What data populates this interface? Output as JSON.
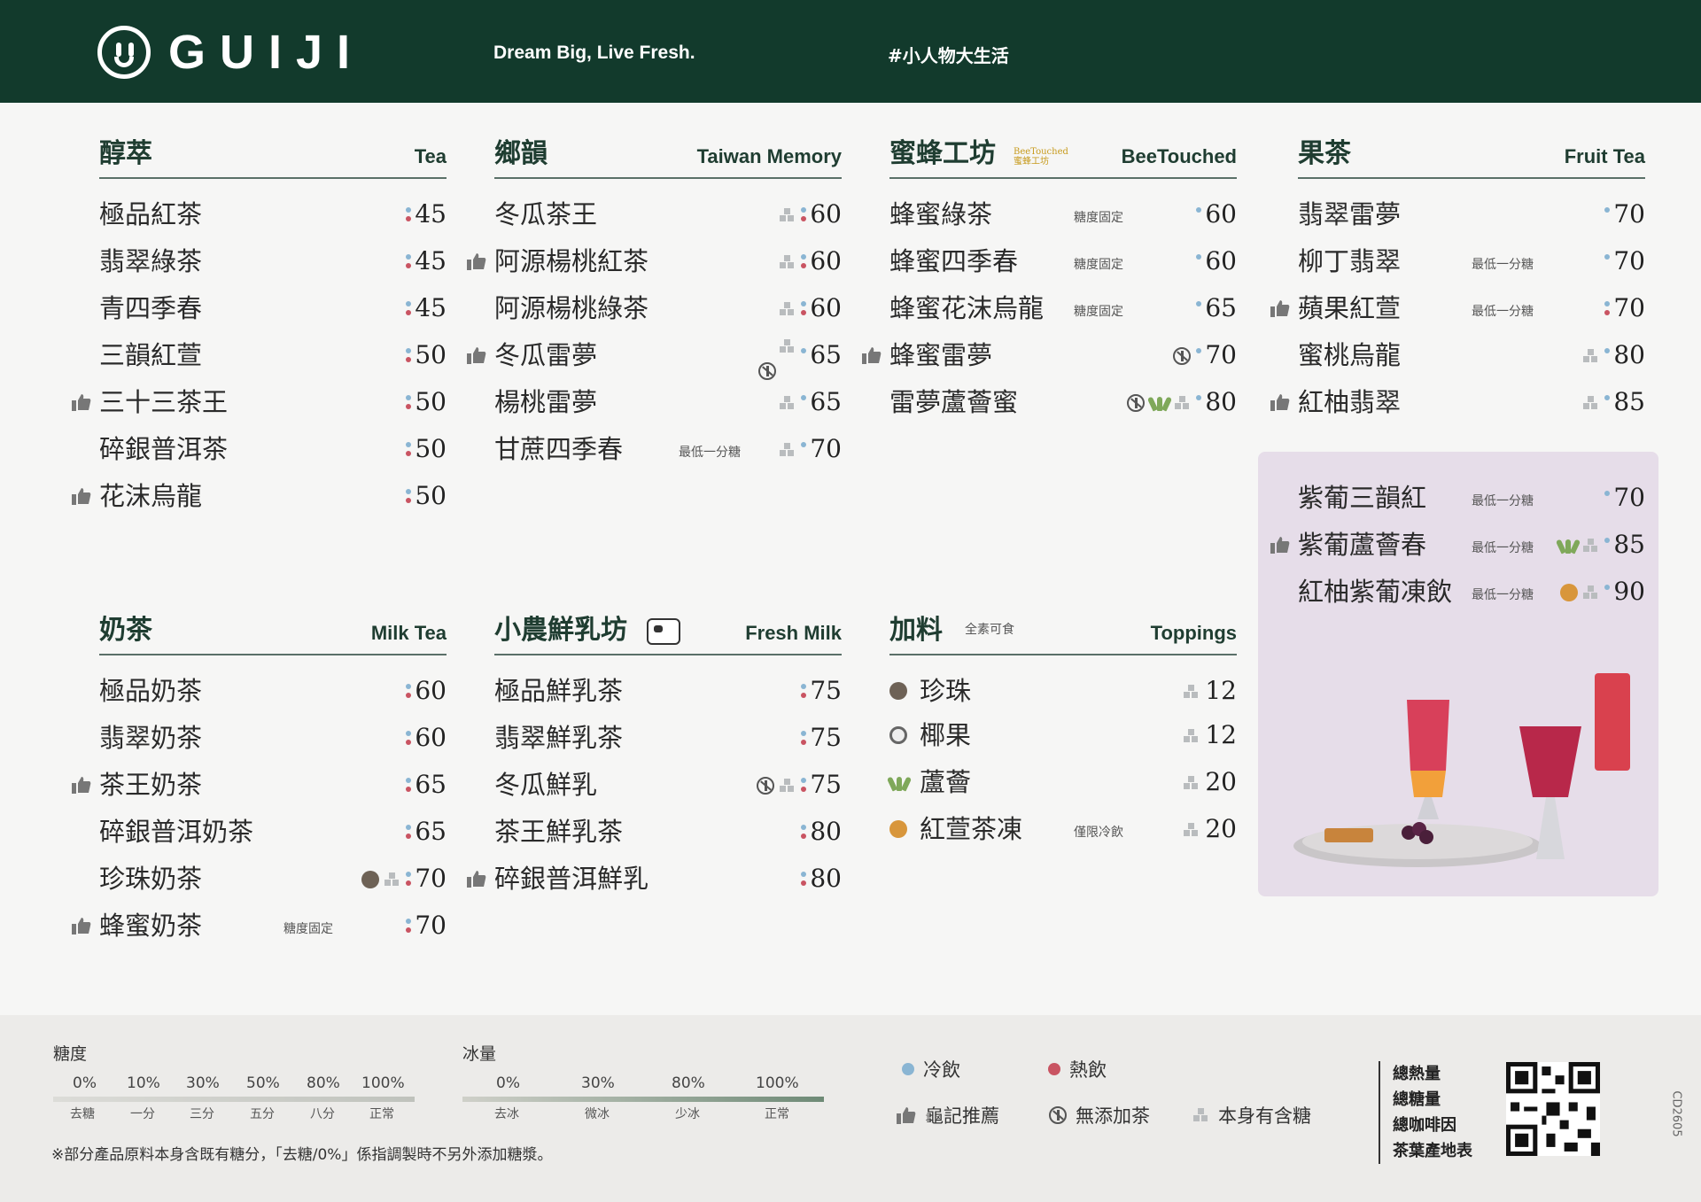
{
  "header": {
    "brand": "GUIJI",
    "tagline": "Dream Big, Live Fresh.",
    "hashtag": "#小人物大生活"
  },
  "colors": {
    "header_bg": "#123a2c",
    "cold_dot": "#8ab5d3",
    "hot_dot": "#c95462",
    "promo_bg": "#e6dde9"
  },
  "sections": {
    "tea": {
      "title": "醇萃",
      "en": "Tea",
      "items": [
        {
          "name": "極品紅茶",
          "price": "45"
        },
        {
          "name": "翡翠綠茶",
          "price": "45"
        },
        {
          "name": "青四季春",
          "price": "45"
        },
        {
          "name": "三韻紅萱",
          "price": "50"
        },
        {
          "name": "三十三茶王",
          "price": "50",
          "recommended": true
        },
        {
          "name": "碎銀普洱茶",
          "price": "50"
        },
        {
          "name": "花沫烏龍",
          "price": "50",
          "recommended": true
        }
      ]
    },
    "taiwan": {
      "title": "鄉韻",
      "en": "Taiwan Memory",
      "items": [
        {
          "name": "冬瓜茶王",
          "price": "60"
        },
        {
          "name": "阿源楊桃紅茶",
          "price": "60",
          "recommended": true
        },
        {
          "name": "阿源楊桃綠茶",
          "price": "60"
        },
        {
          "name": "冬瓜雷夢",
          "price": "65",
          "recommended": true
        },
        {
          "name": "楊桃雷夢",
          "price": "65"
        },
        {
          "name": "甘蔗四季春",
          "price": "70",
          "note": "最低一分糖"
        }
      ]
    },
    "bee": {
      "title": "蜜蜂工坊",
      "en": "BeeTouched",
      "badge_line1": "BeeTouched",
      "badge_line2": "蜜蜂工坊",
      "items": [
        {
          "name": "蜂蜜綠茶",
          "price": "60",
          "note": "糖度固定"
        },
        {
          "name": "蜂蜜四季春",
          "price": "60",
          "note": "糖度固定"
        },
        {
          "name": "蜂蜜花沫烏龍",
          "price": "65",
          "note": "糖度固定"
        },
        {
          "name": "蜂蜜雷夢",
          "price": "70",
          "recommended": true
        },
        {
          "name": "雷夢蘆薈蜜",
          "price": "80"
        }
      ]
    },
    "fruit": {
      "title": "果茶",
      "en": "Fruit Tea",
      "items": [
        {
          "name": "翡翠雷夢",
          "price": "70"
        },
        {
          "name": "柳丁翡翠",
          "price": "70",
          "note": "最低一分糖"
        },
        {
          "name": "蘋果紅萱",
          "price": "70",
          "note": "最低一分糖",
          "recommended": true
        },
        {
          "name": "蜜桃烏龍",
          "price": "80"
        },
        {
          "name": "紅柚翡翠",
          "price": "85",
          "recommended": true
        }
      ]
    },
    "promo": {
      "items": [
        {
          "name": "紫葡三韻紅",
          "price": "70",
          "note": "最低一分糖"
        },
        {
          "name": "紫葡蘆薈春",
          "price": "85",
          "note": "最低一分糖",
          "recommended": true
        },
        {
          "name": "紅柚紫葡凍飲",
          "price": "90",
          "note": "最低一分糖"
        }
      ]
    },
    "milktea": {
      "title": "奶茶",
      "en": "Milk Tea",
      "items": [
        {
          "name": "極品奶茶",
          "price": "60"
        },
        {
          "name": "翡翠奶茶",
          "price": "60"
        },
        {
          "name": "茶王奶茶",
          "price": "65",
          "recommended": true
        },
        {
          "name": "碎銀普洱奶茶",
          "price": "65"
        },
        {
          "name": "珍珠奶茶",
          "price": "70"
        },
        {
          "name": "蜂蜜奶茶",
          "price": "70",
          "note": "糖度固定",
          "recommended": true
        }
      ]
    },
    "freshmilk": {
      "title": "小農鮮乳坊",
      "en": "Fresh Milk",
      "cow_label": "鮮乳坊",
      "items": [
        {
          "name": "極品鮮乳茶",
          "price": "75"
        },
        {
          "name": "翡翠鮮乳茶",
          "price": "75"
        },
        {
          "name": "冬瓜鮮乳",
          "price": "75"
        },
        {
          "name": "茶王鮮乳茶",
          "price": "80"
        },
        {
          "name": "碎銀普洱鮮乳",
          "price": "80",
          "recommended": true
        }
      ]
    },
    "toppings": {
      "title": "加料",
      "en": "Toppings",
      "sub": "全素可食",
      "items": [
        {
          "name": "珍珠",
          "price": "12"
        },
        {
          "name": "椰果",
          "price": "12"
        },
        {
          "name": "蘆薈",
          "price": "20"
        },
        {
          "name": "紅萱茶凍",
          "price": "20",
          "note": "僅限冷飲"
        }
      ]
    }
  },
  "footer": {
    "sugar": {
      "label": "糖度",
      "levels": [
        "0%",
        "10%",
        "30%",
        "50%",
        "80%",
        "100%"
      ],
      "names": [
        "去糖",
        "一分",
        "三分",
        "五分",
        "八分",
        "正常"
      ]
    },
    "ice": {
      "label": "冰量",
      "levels": [
        "0%",
        "30%",
        "80%",
        "100%"
      ],
      "names": [
        "去冰",
        "微冰",
        "少冰",
        "正常"
      ]
    },
    "legend": {
      "cold": "冷飲",
      "hot": "熱飲",
      "recommended": "龜記推薦",
      "no_added_tea": "無添加茶",
      "contains_sugar": "本身有含糖"
    },
    "info": [
      "總熱量",
      "總糖量",
      "總咖啡因",
      "茶葉產地表"
    ],
    "footnote": "※部分產品原料本身含既有糖分，「去糖/0%」係指調製時不另外添加糖漿。",
    "code": "CD2605"
  }
}
